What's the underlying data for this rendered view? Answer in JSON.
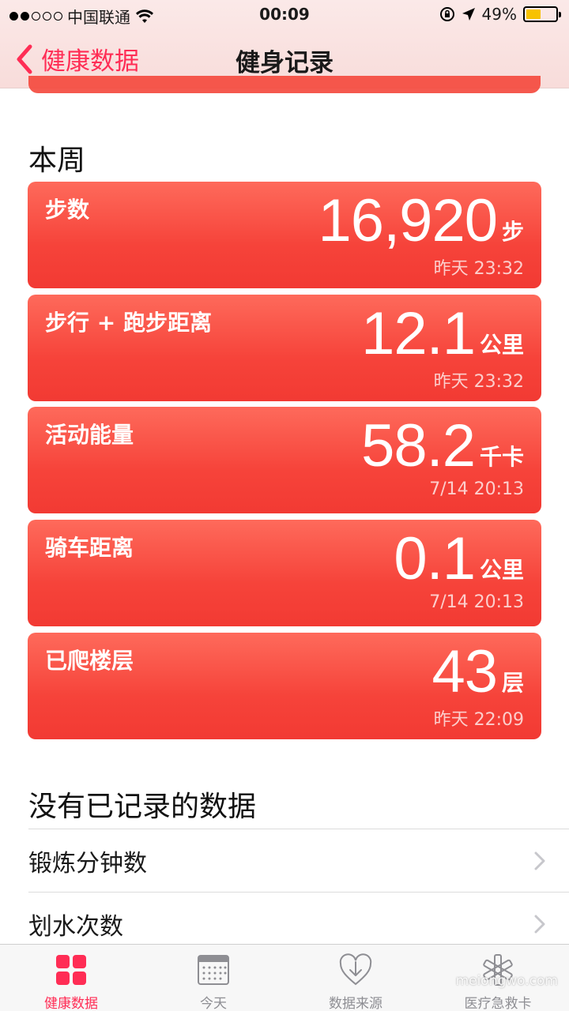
{
  "status_bar": {
    "carrier": "中国联通",
    "time": "00:09",
    "battery_pct": "49%",
    "battery_level": 0.49
  },
  "nav": {
    "back_label": "健康数据",
    "title": "健身记录"
  },
  "this_week": {
    "heading": "本周",
    "cards": [
      {
        "label": "步数",
        "value": "16,920",
        "unit": "步",
        "time": "昨天 23:32"
      },
      {
        "label": "步行 + 跑步距离",
        "value": "12.1",
        "unit": "公里",
        "time": "昨天 23:32"
      },
      {
        "label": "活动能量",
        "value": "58.2",
        "unit": "千卡",
        "time": "7/14 20:13"
      },
      {
        "label": "骑车距离",
        "value": "0.1",
        "unit": "公里",
        "time": "7/14 20:13"
      },
      {
        "label": "已爬楼层",
        "value": "43",
        "unit": "层",
        "time": "昨天 22:09"
      }
    ]
  },
  "no_data": {
    "heading": "没有已记录的数据",
    "items": [
      "锻炼分钟数",
      "划水次数"
    ]
  },
  "tabs": [
    {
      "label": "健康数据",
      "icon": "dashboard-grid-icon",
      "active": true
    },
    {
      "label": "今天",
      "icon": "calendar-icon",
      "active": false
    },
    {
      "label": "数据来源",
      "icon": "heart-download-icon",
      "active": false
    },
    {
      "label": "医疗急救卡",
      "icon": "asterisk-icon",
      "active": false
    }
  ],
  "watermark": "meiongwo.com",
  "colors": {
    "accent": "#ff2d55",
    "card": "#f4473b",
    "battery": "#f7c200"
  }
}
